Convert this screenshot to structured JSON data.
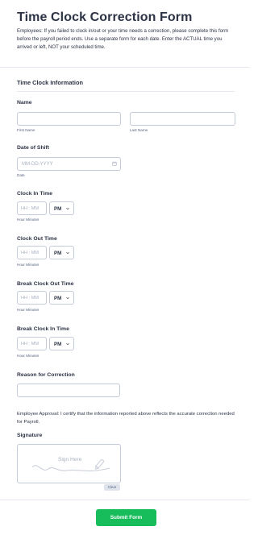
{
  "form": {
    "title": "Time Clock Correction Form",
    "description": "Employees: If you failed to clock in/out or your time needs a correction, please complete this form before the payroll period ends. Use a separate form for each date. Enter the ACTUAL time you arrived or left, NOT your scheduled time."
  },
  "section": {
    "title": "Time Clock Information"
  },
  "name_field": {
    "label": "Name",
    "first_sublabel": "First Name",
    "last_sublabel": "Last Name",
    "first_value": "",
    "last_value": ""
  },
  "date_field": {
    "label": "Date of Shift",
    "placeholder": "MM-DD-YYYY",
    "sublabel": "Date",
    "icon": "calendar-icon"
  },
  "time_fields": [
    {
      "label": "Clock In Time",
      "placeholder": "HH : MM",
      "ampm": "PM",
      "sublabel": "Hour Minutes"
    },
    {
      "label": "Clock Out Time",
      "placeholder": "HH : MM",
      "ampm": "PM",
      "sublabel": "Hour Minutes"
    },
    {
      "label": "Break Clock Out Time",
      "placeholder": "HH : MM",
      "ampm": "PM",
      "sublabel": "Hour Minutes"
    },
    {
      "label": "Break Clock In Time",
      "placeholder": "HH : MM",
      "ampm": "PM",
      "sublabel": "Hour Minutes"
    }
  ],
  "reason_field": {
    "label": "Reason for Correction",
    "value": ""
  },
  "approval_text": "Employee Approval: I certify that the information reported above reflects the accurate correction needed for Payroll.",
  "signature": {
    "label": "Signature",
    "placeholder": "Sign Here",
    "clear_label": "Clear",
    "icon": "pen-icon"
  },
  "submit_label": "Submit Form",
  "colors": {
    "submit": "#18bd5b",
    "border": "#c3cad8",
    "text": "#2c3345",
    "placeholder": "#a8b0c0"
  }
}
